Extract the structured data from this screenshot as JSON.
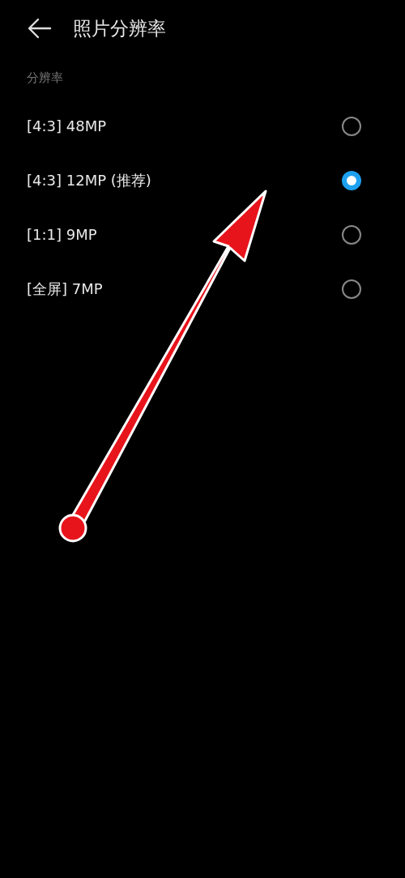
{
  "header": {
    "title": "照片分辨率"
  },
  "section": {
    "title": "分辨率"
  },
  "options": [
    {
      "label": "[4:3] 48MP",
      "selected": false
    },
    {
      "label": "[4:3] 12MP (推荐)",
      "selected": true
    },
    {
      "label": "[1:1] 9MP",
      "selected": false
    },
    {
      "label": "[全屏] 7MP",
      "selected": false
    }
  ]
}
